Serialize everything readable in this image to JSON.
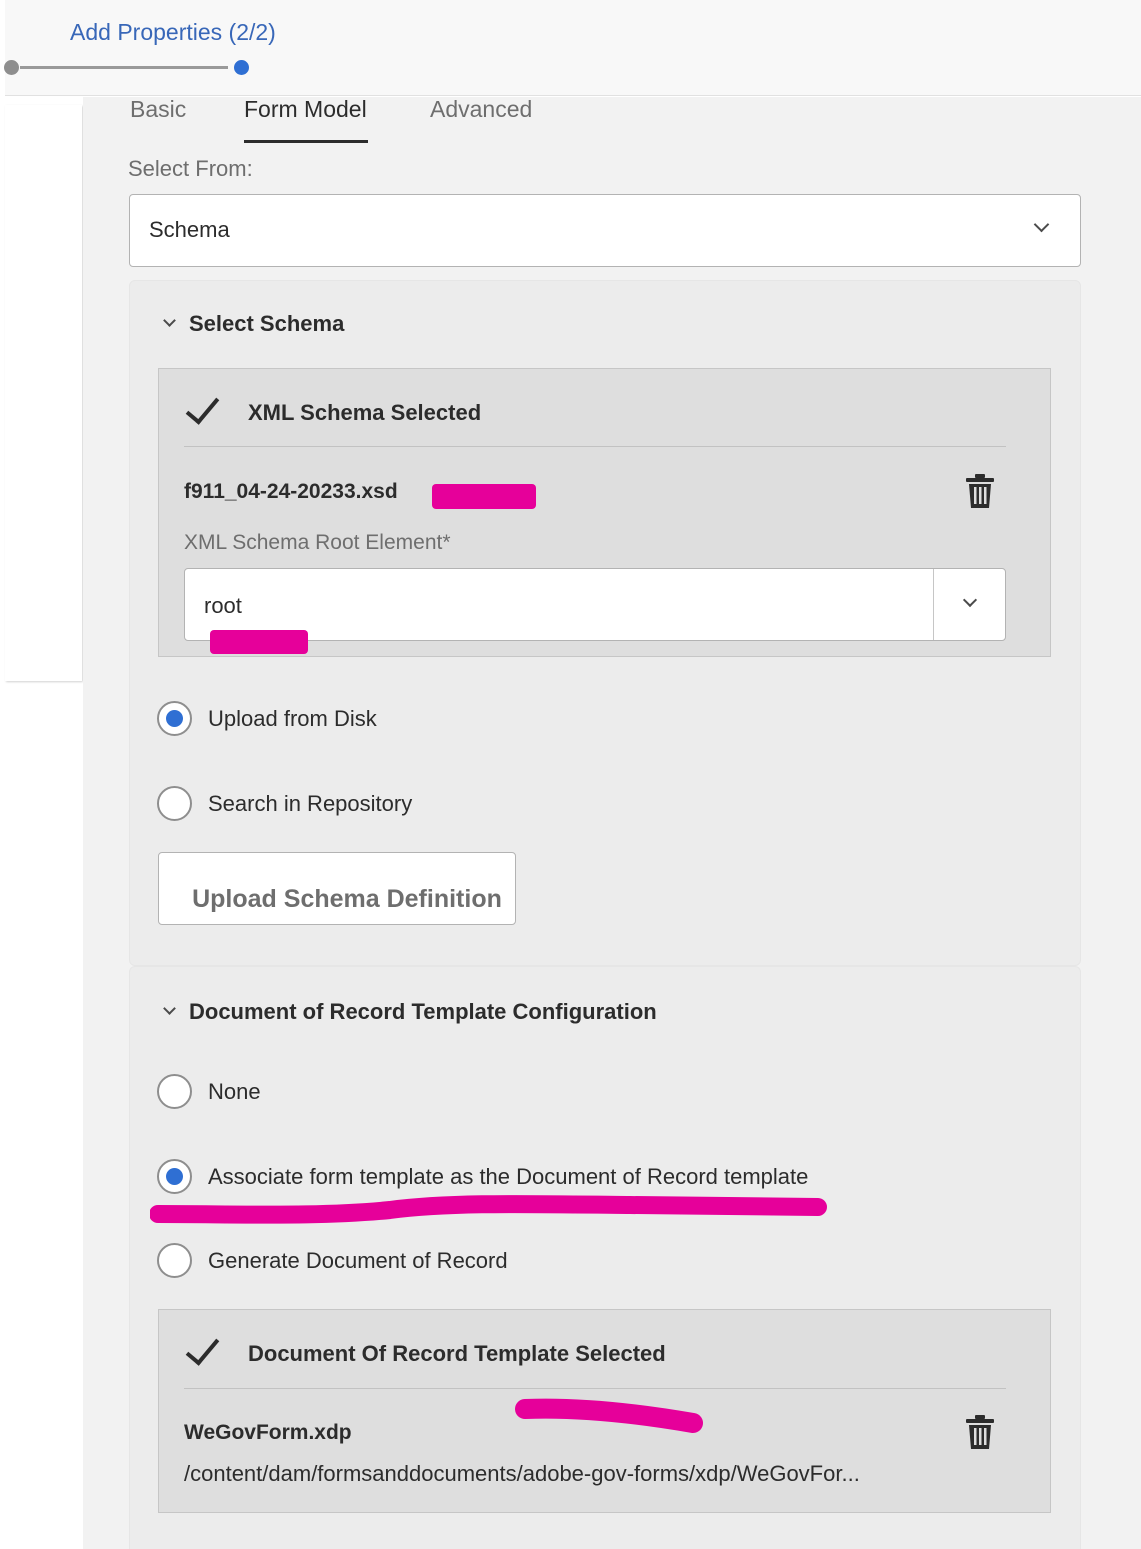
{
  "wizard": {
    "step_title": "Add Properties (2/2)"
  },
  "tabs": [
    {
      "label": "Basic",
      "active": false
    },
    {
      "label": "Form Model",
      "active": true
    },
    {
      "label": "Advanced",
      "active": false
    }
  ],
  "select_from": {
    "label": "Select From:",
    "value": "Schema"
  },
  "select_schema": {
    "title": "Select Schema",
    "card_title": "XML Schema Selected",
    "file_name": "f911_04-24-20233.xsd",
    "root_label": "XML Schema Root Element*",
    "root_value": "root",
    "options": [
      {
        "label": "Upload from Disk",
        "selected": true
      },
      {
        "label": "Search in Repository",
        "selected": false
      }
    ],
    "upload_button": "Upload Schema Definition"
  },
  "dor": {
    "title": "Document of Record Template Configuration",
    "options": [
      {
        "label": "None",
        "selected": false
      },
      {
        "label": "Associate form template as the Document of Record template",
        "selected": true
      },
      {
        "label": "Generate Document of Record",
        "selected": false
      }
    ],
    "card_title": "Document Of Record Template Selected",
    "file_name": "WeGovForm.xdp",
    "file_path": "/content/dam/formsanddocuments/adobe-gov-forms/xdp/WeGovFor..."
  },
  "icons": [
    "checkmark-icon",
    "trash-icon",
    "chevron-down-icon"
  ],
  "colors": {
    "accent": "#2f6fd3",
    "link": "#3867b8",
    "annotation": "#e6009a"
  }
}
